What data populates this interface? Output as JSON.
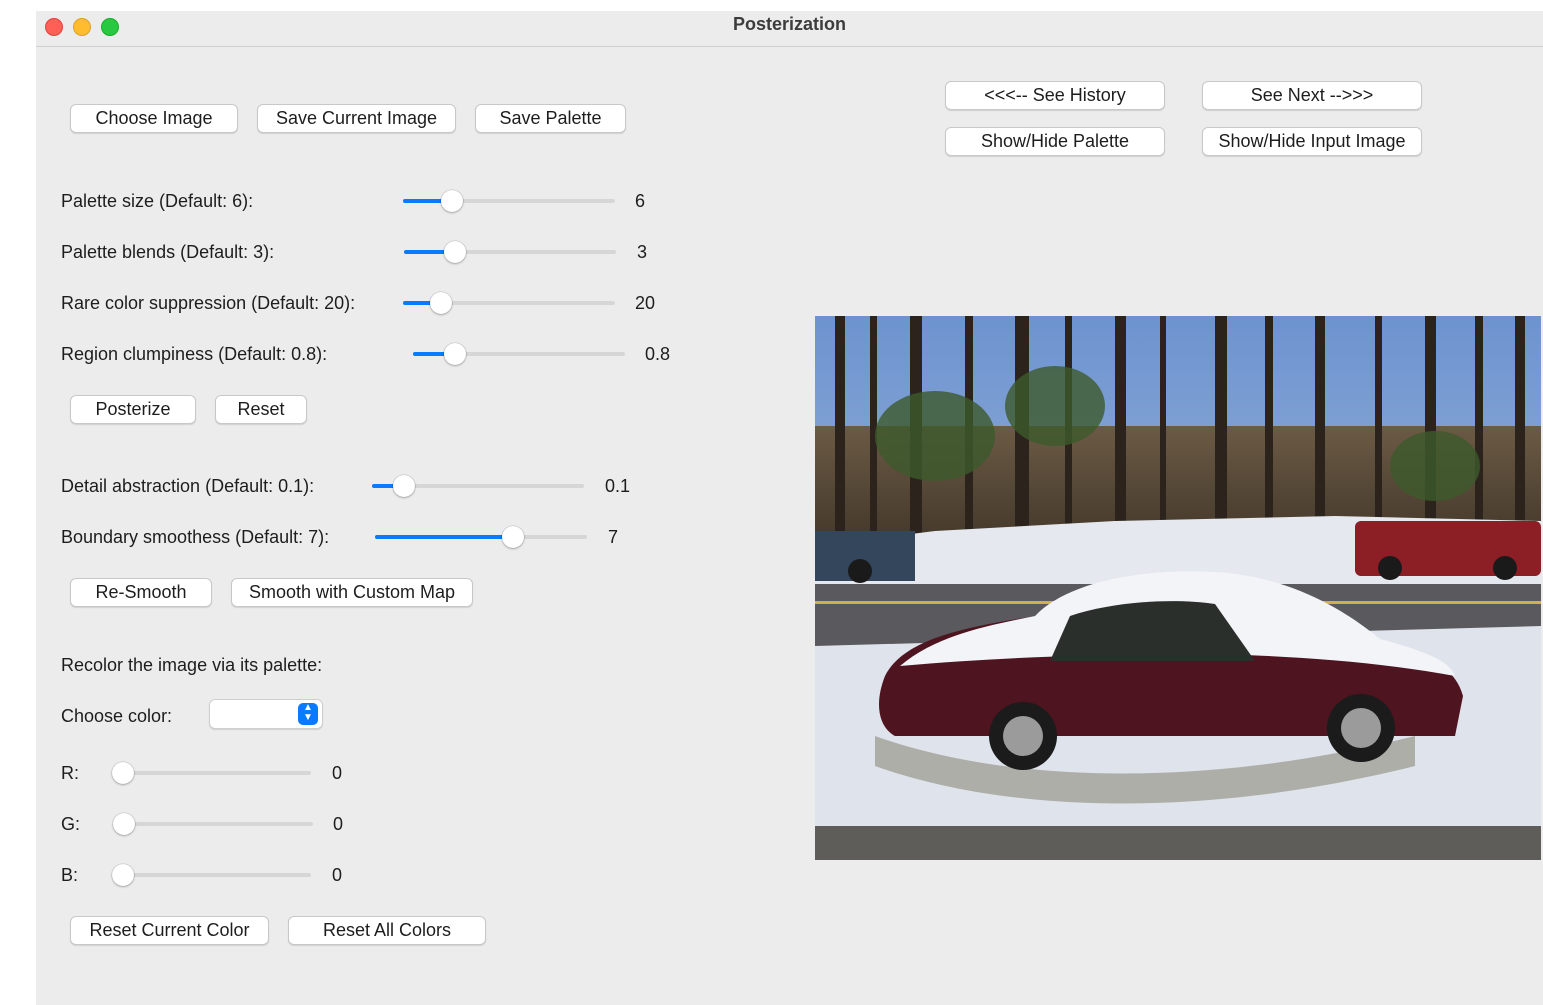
{
  "window": {
    "title": "Posterization"
  },
  "toolbar": {
    "choose_image": "Choose Image",
    "save_current_image": "Save Current Image",
    "save_palette": "Save Palette"
  },
  "nav": {
    "see_history": "<<<-- See History",
    "see_next": "See Next -->>>",
    "toggle_palette": "Show/Hide Palette",
    "toggle_input_image": "Show/Hide Input Image"
  },
  "posterize_params": [
    {
      "label": "Palette size (Default: 6):",
      "value": "6",
      "level": 0.23
    },
    {
      "label": "Palette blends (Default: 3):",
      "value": "3",
      "level": 0.24
    },
    {
      "label": "Rare color suppression (Default: 20):",
      "value": "20",
      "level": 0.18
    },
    {
      "label": "Region clumpiness (Default: 0.8):",
      "value": "0.8",
      "level": 0.2
    }
  ],
  "posterize_buttons": {
    "posterize": "Posterize",
    "reset": "Reset"
  },
  "smooth_params": [
    {
      "label": "Detail abstraction (Default: 0.1):",
      "value": "0.1",
      "level": 0.15
    },
    {
      "label": "Boundary smoothess (Default: 7):",
      "value": "7",
      "level": 0.65
    }
  ],
  "smooth_buttons": {
    "re_smooth": "Re-Smooth",
    "custom_map": "Smooth with Custom Map"
  },
  "recolor": {
    "heading": "Recolor the image via its palette:",
    "choose_color_label": "Choose color:",
    "selected_color": "",
    "channels": [
      {
        "label": "R:",
        "value": "0",
        "level": 0
      },
      {
        "label": "G:",
        "value": "0",
        "level": 0
      },
      {
        "label": "B:",
        "value": "0",
        "level": 0
      }
    ],
    "reset_current": "Reset Current Color",
    "reset_all": "Reset All Colors"
  },
  "colors": {
    "accent": "#0a7aff",
    "window_bg": "#ececec"
  }
}
